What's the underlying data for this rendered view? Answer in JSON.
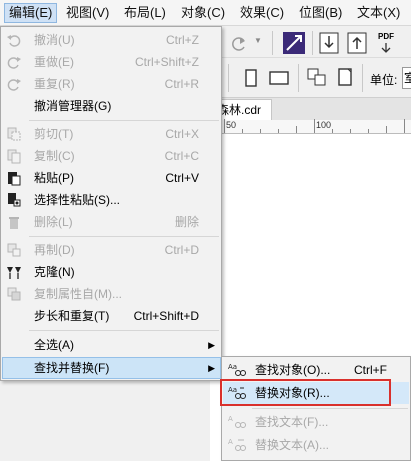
{
  "menubar": {
    "items": [
      {
        "label": "编辑(E)",
        "active": true
      },
      {
        "label": "视图(V)"
      },
      {
        "label": "布局(L)"
      },
      {
        "label": "对象(C)"
      },
      {
        "label": "效果(C)"
      },
      {
        "label": "位图(B)"
      },
      {
        "label": "文本(X)"
      }
    ]
  },
  "toolbar": {
    "pdf_label": "PDF",
    "unit_label": "单位:",
    "unit_value": "室"
  },
  "document": {
    "tab_label": "森林.cdr",
    "ruler_labels": [
      "50",
      "100"
    ]
  },
  "edit_menu": {
    "items": [
      {
        "label": "撤消(U)",
        "shortcut": "Ctrl+Z",
        "disabled": true,
        "icon": "undo-icon"
      },
      {
        "label": "重做(E)",
        "shortcut": "Ctrl+Shift+Z",
        "disabled": true,
        "icon": "redo-icon"
      },
      {
        "label": "重复(R)",
        "shortcut": "Ctrl+R",
        "disabled": true,
        "icon": "repeat-icon"
      },
      {
        "label": "撤消管理器(G)",
        "shortcut": "",
        "disabled": false,
        "icon": ""
      },
      {
        "label": "剪切(T)",
        "shortcut": "Ctrl+X",
        "disabled": true,
        "icon": "cut-icon"
      },
      {
        "label": "复制(C)",
        "shortcut": "Ctrl+C",
        "disabled": true,
        "icon": "copy-icon"
      },
      {
        "label": "粘贴(P)",
        "shortcut": "Ctrl+V",
        "disabled": false,
        "icon": "paste-icon"
      },
      {
        "label": "选择性粘贴(S)...",
        "shortcut": "",
        "disabled": false,
        "icon": "paste-special-icon"
      },
      {
        "label": "删除(L)",
        "shortcut": "删除",
        "disabled": true,
        "icon": "trash-icon"
      },
      {
        "label": "再制(D)",
        "shortcut": "Ctrl+D",
        "disabled": true,
        "icon": "duplicate-icon"
      },
      {
        "label": "克隆(N)",
        "shortcut": "",
        "disabled": false,
        "icon": "clone-icon"
      },
      {
        "label": "复制属性自(M)...",
        "shortcut": "",
        "disabled": true,
        "icon": "copy-properties-icon"
      },
      {
        "label": "步长和重复(T)",
        "shortcut": "Ctrl+Shift+D",
        "disabled": false,
        "icon": ""
      },
      {
        "label": "全选(A)",
        "shortcut": "",
        "disabled": false,
        "icon": "",
        "submenu": true
      },
      {
        "label": "查找并替换(F)",
        "shortcut": "",
        "disabled": false,
        "icon": "",
        "submenu": true,
        "highlighted": true
      }
    ]
  },
  "find_replace_submenu": {
    "items": [
      {
        "label": "查找对象(O)...",
        "shortcut": "Ctrl+F",
        "disabled": false,
        "icon": "find-objects-icon"
      },
      {
        "label": "替换对象(R)...",
        "shortcut": "",
        "disabled": false,
        "icon": "replace-objects-icon",
        "highlighted": true
      },
      {
        "label": "查找文本(F)...",
        "shortcut": "",
        "disabled": true,
        "icon": "find-text-icon"
      },
      {
        "label": "替换文本(A)...",
        "shortcut": "",
        "disabled": true,
        "icon": "replace-text-icon"
      }
    ]
  },
  "colors": {
    "highlight": "#cce4f7",
    "annotation_box": "#d9302c",
    "disabled_text": "#a8a8a8"
  }
}
